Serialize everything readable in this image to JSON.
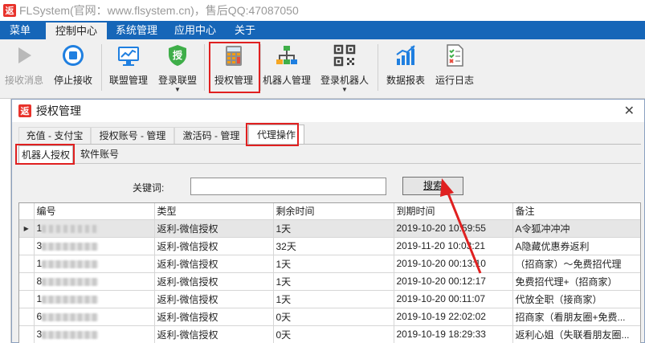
{
  "window": {
    "title": "FLSystem(官网：www.flsystem.cn)，售后QQ:47087050",
    "logo_char": "返"
  },
  "menu_tabs": [
    {
      "label": "菜单"
    },
    {
      "label": "控制中心"
    },
    {
      "label": "系统管理"
    },
    {
      "label": "应用中心"
    },
    {
      "label": "关于"
    }
  ],
  "ribbon": {
    "receive_msg": "接收消息",
    "stop_receive": "停止接收",
    "alliance_mgmt": "联盟管理",
    "login_alliance": "登录联盟",
    "auth_mgmt": "授权管理",
    "robot_mgmt": "机器人管理",
    "login_robot": "登录机器人",
    "data_report": "数据报表",
    "run_log": "运行日志",
    "caret": "▼"
  },
  "dialog": {
    "logo_char": "返",
    "title": "授权管理",
    "close": "✕",
    "tabs": [
      {
        "label": "充值 - 支付宝"
      },
      {
        "label": "授权账号 - 管理"
      },
      {
        "label": "激活码 - 管理"
      },
      {
        "label": "代理操作"
      }
    ],
    "subtabs": [
      {
        "label": "机器人授权"
      },
      {
        "label": "软件账号"
      }
    ],
    "keyword_label": "关键词:",
    "keyword_value": "",
    "search_label": "搜索"
  },
  "grid": {
    "columns": [
      "编号",
      "类型",
      "剩余时间",
      "到期时间",
      "备注"
    ],
    "rows": [
      {
        "id": "1",
        "type": "返利-微信授权",
        "remain": "1天",
        "expire": "2019-10-20 10:59:55",
        "note": "A令狐冲冲冲"
      },
      {
        "id": "3",
        "type": "返利-微信授权",
        "remain": "32天",
        "expire": "2019-11-20 10:03:21",
        "note": "A隐藏优惠券返利"
      },
      {
        "id": "1",
        "type": "返利-微信授权",
        "remain": "1天",
        "expire": "2019-10-20 00:13:10",
        "note": "（招商家）～免费招代理"
      },
      {
        "id": "8",
        "type": "返利-微信授权",
        "remain": "1天",
        "expire": "2019-10-20 00:12:17",
        "note": "免费招代理+（招商家）"
      },
      {
        "id": "1",
        "type": "返利-微信授权",
        "remain": "1天",
        "expire": "2019-10-20 00:11:07",
        "note": "代放全职（接商家）"
      },
      {
        "id": "6",
        "type": "返利-微信授权",
        "remain": "0天",
        "expire": "2019-10-19 22:02:02",
        "note": "招商家（看朋友圈+免费..."
      },
      {
        "id": "3",
        "type": "返利-微信授权",
        "remain": "0天",
        "expire": "2019-10-19 18:29:33",
        "note": "返利心姐（失联看朋友圈..."
      }
    ],
    "row_indicator": "▶"
  },
  "colors": {
    "menu_blue": "#1666b8",
    "highlight_red": "#e02020"
  }
}
